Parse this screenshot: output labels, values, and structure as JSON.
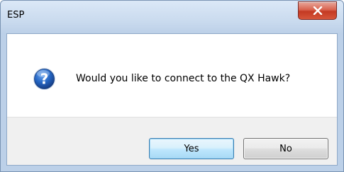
{
  "window": {
    "title": "ESP"
  },
  "dialog": {
    "message": "Would you like to connect to the QX Hawk?",
    "icon": "question-icon"
  },
  "buttons": {
    "yes_label": "Yes",
    "no_label": "No"
  },
  "colors": {
    "close_button": "#c43a23",
    "icon_blue": "#1f5fb8"
  }
}
